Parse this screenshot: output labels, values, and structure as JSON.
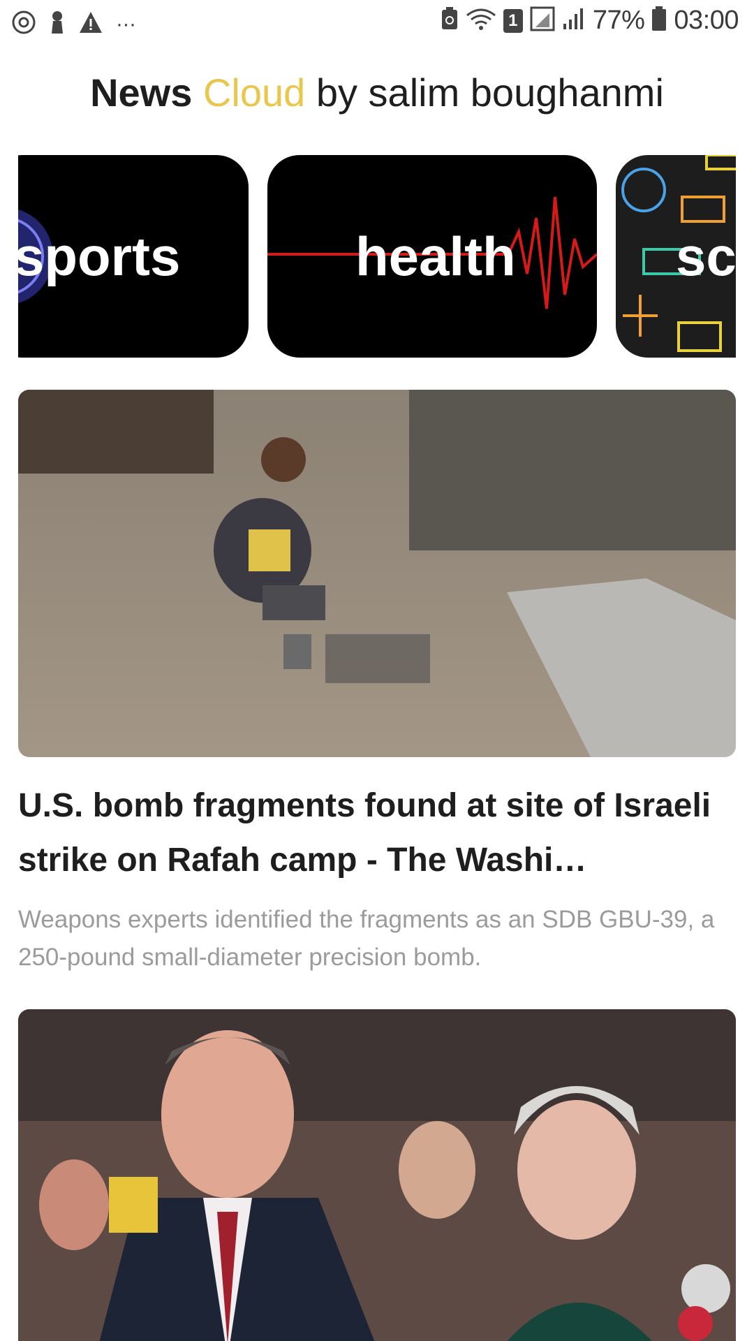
{
  "status_bar": {
    "battery_percent": "77%",
    "time": "03:00",
    "sim_badge": "1",
    "overflow_dots": "···"
  },
  "header": {
    "title_part1": "News",
    "title_part2": "Cloud",
    "title_part3": "by salim boughanmi",
    "accent_color": "#e9c64c"
  },
  "categories": [
    {
      "label": "sports",
      "icon": "globe-icon"
    },
    {
      "label": "health",
      "icon": "heartbeat-icon"
    },
    {
      "label": "sc",
      "icon": "science-pattern-icon"
    }
  ],
  "articles": [
    {
      "headline": "U.S. bomb fragments found at site of Israeli strike on Rafah camp - The Washi…",
      "description": "Weapons experts identified the fragments as an SDB GBU-39, a 250-pound small-diameter precision bomb.",
      "image": "rubble-photo"
    },
    {
      "image": "crowd-portrait-photo"
    }
  ]
}
